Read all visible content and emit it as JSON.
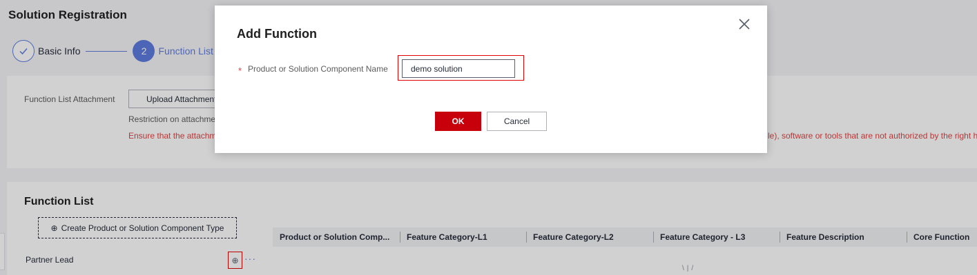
{
  "page": {
    "title": "Solution Registration"
  },
  "steps": [
    {
      "label": "Basic Info",
      "state": "done",
      "icon": "check-icon"
    },
    {
      "number": "2",
      "label": "Function List",
      "state": "active"
    }
  ],
  "attachment": {
    "label": "Function List Attachment",
    "upload_button": "Upload Attachment",
    "restriction_text": "Restriction on attachme",
    "warning_left": "Ensure that the attachm",
    "warning_right": "le), software or tools that are not authorized by the right h"
  },
  "function_list": {
    "title": "Function List",
    "create_type_button": "Create Product or Solution Component Type",
    "tree_items": [
      {
        "label": "Partner Lead"
      }
    ],
    "table_columns": [
      "Product or Solution Comp...",
      "Feature Category-L1",
      "Feature Category-L2",
      "Feature Category - L3",
      "Feature Description",
      "Core Function"
    ]
  },
  "modal": {
    "title": "Add Function",
    "field_label": "Product or Solution Component Name",
    "field_value": "demo solution",
    "required_mark": "*",
    "ok_label": "OK",
    "cancel_label": "Cancel"
  },
  "colors": {
    "accent": "#5e7ce0",
    "primary_button": "#c7000b",
    "warning_text": "#e14242",
    "highlight_border": "#e00000"
  }
}
